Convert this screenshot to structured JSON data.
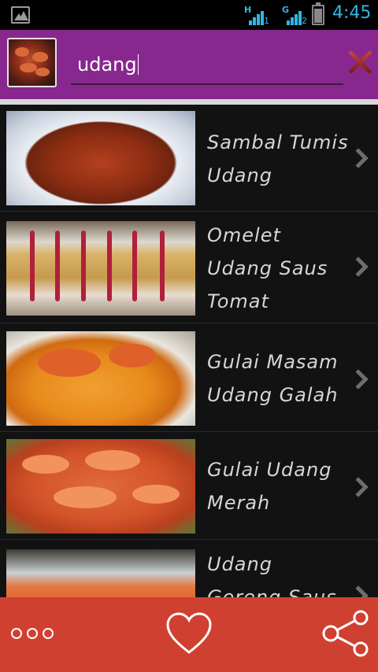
{
  "status_bar": {
    "gallery_icon": "gallery-notification-icon",
    "sim1": {
      "letter": "H",
      "number": "1"
    },
    "sim2": {
      "letter": "G",
      "number": "2"
    },
    "battery_level": 0.8,
    "clock": "4:45",
    "accent_color": "#33b5e5"
  },
  "header": {
    "background_color": "#88288f",
    "search": {
      "value": "udang",
      "placeholder": ""
    },
    "clear_icon": "close-x-icon"
  },
  "recipes": [
    {
      "title": "Sambal Tumis Udang",
      "thumb": "sambal-tumis-udang-photo"
    },
    {
      "title": "Omelet Udang Saus Tomat",
      "thumb": "omelet-udang-photo"
    },
    {
      "title": "Gulai Masam Udang Galah",
      "thumb": "gulai-masam-photo"
    },
    {
      "title": "Gulai Udang Merah",
      "thumb": "gulai-udang-merah-photo"
    },
    {
      "title": "Udang Goreng Saus",
      "thumb": "udang-goreng-photo"
    }
  ],
  "bottom_bar": {
    "background_color": "#d04030",
    "more_icon": "more-dots-icon",
    "favorite_icon": "heart-icon",
    "share_icon": "share-icon"
  }
}
